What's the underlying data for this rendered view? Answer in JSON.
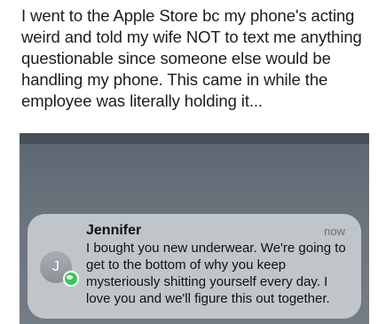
{
  "post": {
    "text": "I went to the Apple Store bc my phone's acting weird and told my wife NOT to text me anything questionable since someone else would be handling my phone. This came in while the employee was literally holding it..."
  },
  "notification": {
    "sender": "Jennifer",
    "time": "now",
    "avatar_initial": "J",
    "app_icon": "messages-icon",
    "message": "I bought you new underwear. We're going to get to the bottom of why you keep mysteriously shitting yourself every day. I love you and we'll figure this out together."
  },
  "colors": {
    "messages_green": "#34c759",
    "notification_bg": "#c8ccd0"
  }
}
